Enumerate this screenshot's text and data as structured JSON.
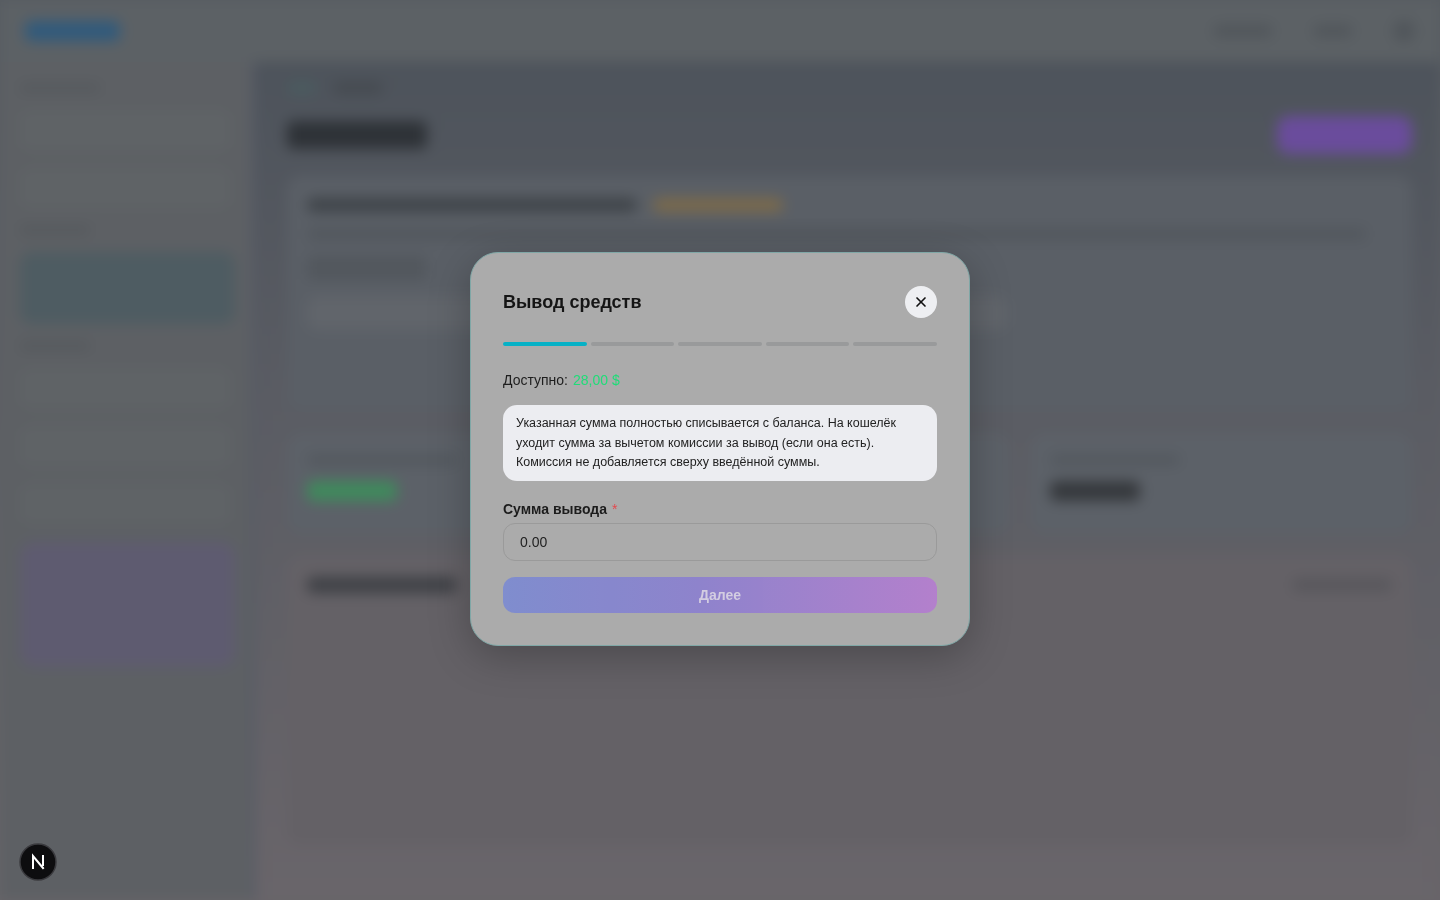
{
  "modal": {
    "title": "Вывод средств",
    "steps": [
      {
        "active": true
      },
      {
        "active": false
      },
      {
        "active": false
      },
      {
        "active": false
      },
      {
        "active": false
      }
    ],
    "available": {
      "label": "Доступно:",
      "amount": "28,00 $"
    },
    "notice": "Указанная сумма полностью списывается с баланса. На кошелёк уходит сумма за вычетом комиссии за вывод (если она есть). Комиссия не добавляется сверху введённой суммы.",
    "amount_field": {
      "label": "Сумма вывода",
      "required_mark": "*",
      "value": "0.00"
    },
    "next_button": {
      "label": "Далее",
      "disabled": true
    }
  }
}
